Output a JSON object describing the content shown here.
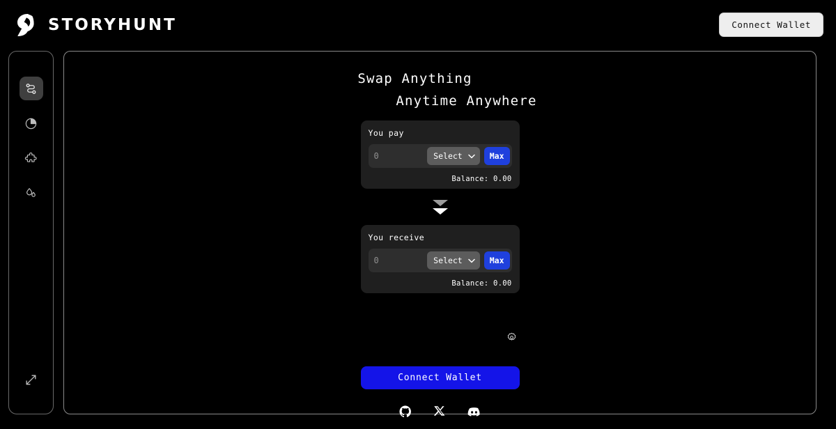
{
  "brand": {
    "name": "STORYHUNT",
    "logo_icon": "storyhunt-logo-icon"
  },
  "header": {
    "connect_wallet_label": "Connect Wallet"
  },
  "sidebar": {
    "items": [
      {
        "icon": "swap-icon",
        "name": "swap",
        "active": true
      },
      {
        "icon": "pie-chart-icon",
        "name": "portfolio",
        "active": false
      },
      {
        "icon": "puzzle-piece-icon",
        "name": "integrations",
        "active": false
      },
      {
        "icon": "droplets-icon",
        "name": "liquidity",
        "active": false
      }
    ],
    "bottom_item": {
      "icon": "expand-icon",
      "name": "expand"
    }
  },
  "main": {
    "headline_line1": "Swap Anything",
    "headline_line2": "Anytime Anywhere",
    "pay_card": {
      "label": "You pay",
      "amount_value": "",
      "amount_placeholder": "0",
      "select_label": "Select",
      "chevron_icon": "chevron-down-icon",
      "max_label": "Max",
      "balance": "Balance: 0.00"
    },
    "switch_icon": "switch-direction-icon",
    "receive_card": {
      "label": "You receive",
      "amount_value": "",
      "amount_placeholder": "0",
      "select_label": "Select",
      "chevron_icon": "chevron-down-icon",
      "max_label": "Max",
      "balance": "Balance: 0.00"
    },
    "settings_icon": "gear-icon",
    "connect_wallet_label": "Connect Wallet",
    "socials": [
      {
        "icon": "github-icon",
        "name": "github"
      },
      {
        "icon": "x-twitter-icon",
        "name": "x-twitter"
      },
      {
        "icon": "discord-icon",
        "name": "discord"
      }
    ]
  },
  "colors": {
    "background": "#000000",
    "accent_blue": "#1414e8",
    "max_blue": "#1f40dd",
    "card_bg": "#1f1f1f",
    "input_bg": "#2e2e2e",
    "select_bg": "#5c5c5c",
    "border": "#8a8a8a"
  }
}
